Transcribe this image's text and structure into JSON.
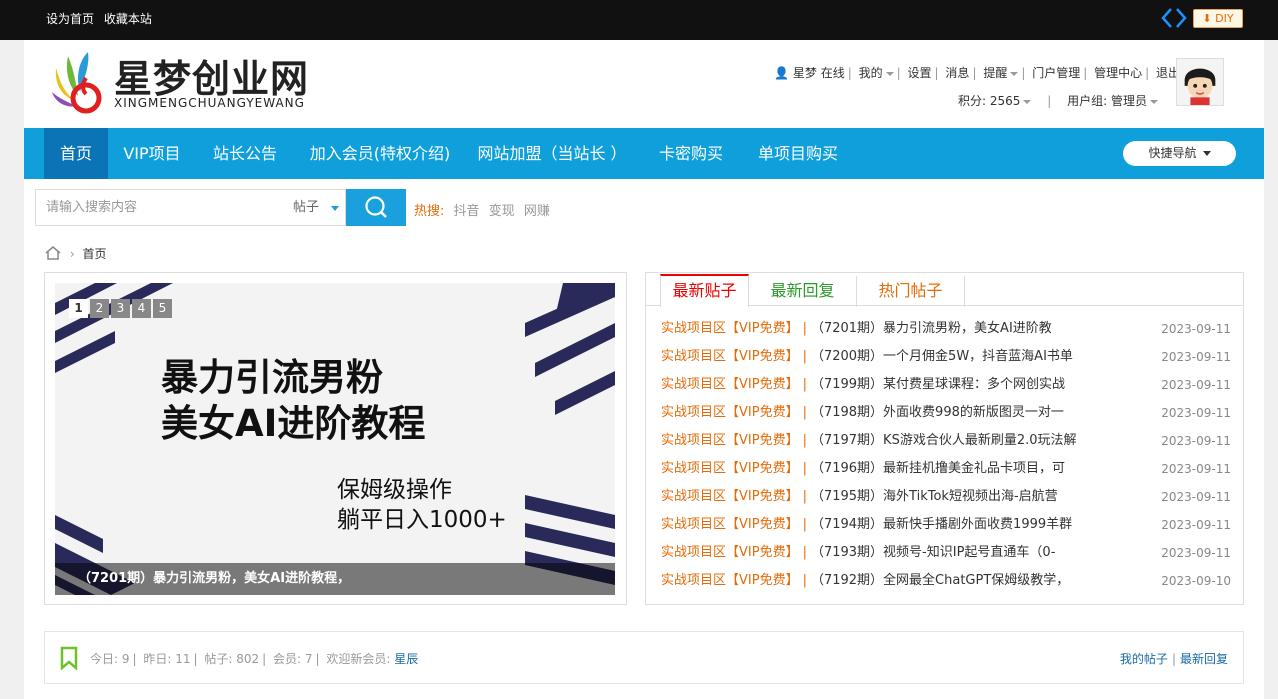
{
  "topbar": {
    "set_home": "设为首页",
    "bookmark": "收藏本站",
    "diy_label": "DIY"
  },
  "header": {
    "site_name": "星梦创业网",
    "site_pinyin": "XINGMENGCHUANGYEWANG",
    "user": {
      "name": "星梦",
      "status": "在线",
      "mine": "我的",
      "settings": "设置",
      "messages": "消息",
      "reminders": "提醒",
      "portal_admin": "门户管理",
      "admin_center": "管理中心",
      "logout": "退出",
      "points": "积分: 2565",
      "group": "用户组: 管理员"
    }
  },
  "nav": {
    "items": [
      {
        "label": "首页"
      },
      {
        "label": "VIP项目"
      },
      {
        "label": "站长公告"
      },
      {
        "label": "加入会员(特权介绍)"
      },
      {
        "label": "网站加盟（当站长 ）"
      },
      {
        "label": "卡密购买"
      },
      {
        "label": "单项目购买"
      }
    ],
    "quick_nav": "快捷导航"
  },
  "search": {
    "placeholder": "请输入搜索内容",
    "type": "帖子",
    "hot_label": "热搜:",
    "hot_terms": [
      "抖音",
      "变现",
      "网赚"
    ]
  },
  "breadcrumb": {
    "home": "首页"
  },
  "slider": {
    "pages": [
      "1",
      "2",
      "3",
      "4",
      "5"
    ],
    "current": "1",
    "headline_1": "暴力引流男粉",
    "headline_2": "美女AI进阶教程",
    "sub_1": "保姆级操作",
    "sub_2": "躺平日入1000+",
    "caption": "（7201期）暴力引流男粉，美女AI进阶教程，"
  },
  "posts": {
    "tabs": [
      "最新贴子",
      "最新回复",
      "热门帖子"
    ],
    "items": [
      {
        "cat": "实战项目区【VIP免费】",
        "title": "（7201期）暴力引流男粉，美女AI进阶教",
        "date": "2023-09-11"
      },
      {
        "cat": "实战项目区【VIP免费】",
        "title": "（7200期）一个月佣金5W，抖音蓝海AI书单",
        "date": "2023-09-11"
      },
      {
        "cat": "实战项目区【VIP免费】",
        "title": "（7199期）某付费星球课程：多个网创实战",
        "date": "2023-09-11"
      },
      {
        "cat": "实战项目区【VIP免费】",
        "title": "（7198期）外面收费998的新版图灵一对一",
        "date": "2023-09-11"
      },
      {
        "cat": "实战项目区【VIP免费】",
        "title": "（7197期）KS游戏合伙人最新刷量2.0玩法解",
        "date": "2023-09-11"
      },
      {
        "cat": "实战项目区【VIP免费】",
        "title": "（7196期）最新挂机撸美金礼品卡项目，可",
        "date": "2023-09-11"
      },
      {
        "cat": "实战项目区【VIP免费】",
        "title": "（7195期）海外TikTok短视频出海-启航营",
        "date": "2023-09-11"
      },
      {
        "cat": "实战项目区【VIP免费】",
        "title": "（7194期）最新快手播剧外面收费1999羊群",
        "date": "2023-09-11"
      },
      {
        "cat": "实战项目区【VIP免费】",
        "title": "（7193期）视频号-知识IP起号直通车（0-",
        "date": "2023-09-11"
      },
      {
        "cat": "实战项目区【VIP免费】",
        "title": "（7192期）全网最全ChatGPT保姆级教学，",
        "date": "2023-09-10"
      }
    ]
  },
  "stats": {
    "today": "今日: 9",
    "yesterday": "昨日: 11",
    "posts": "帖子: 802",
    "members": "会员: 7",
    "welcome": "欢迎新会员:",
    "new_member": "星辰",
    "my_posts": "我的帖子",
    "latest_replies": "最新回复"
  },
  "colors": {
    "nav_bg": "#0fa0db",
    "nav_active": "#0b74b7",
    "accent_orange": "#e36c0a",
    "accent_red": "#e00000",
    "accent_green": "#2a9a2a"
  }
}
